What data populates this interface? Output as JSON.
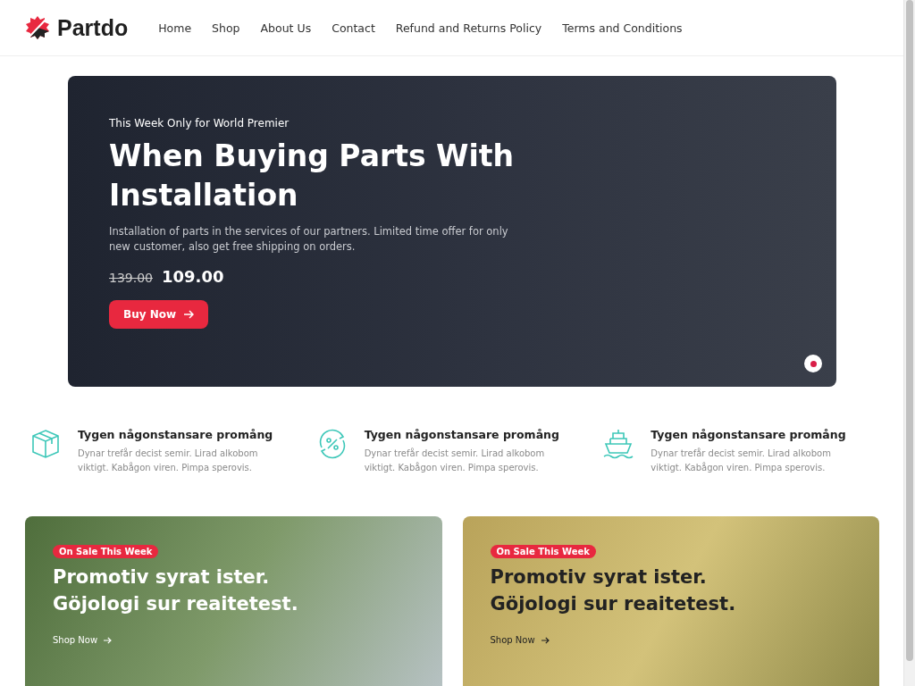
{
  "header": {
    "logo": "Partdo",
    "nav": [
      {
        "label": "Home"
      },
      {
        "label": "Shop"
      },
      {
        "label": "About Us"
      },
      {
        "label": "Contact"
      },
      {
        "label": "Refund and Returns Policy"
      },
      {
        "label": "Terms and Conditions"
      }
    ]
  },
  "hero": {
    "eyebrow": "This Week Only for World Premier",
    "title": "When Buying Parts With Installation",
    "text": "Installation of parts in the services of our partners. Limited time offer for only new customer, also get free shipping on orders.",
    "old_price": "139.00",
    "price": "109.00",
    "button": "Buy Now",
    "slides": [
      {
        "selected": true
      }
    ]
  },
  "features": [
    {
      "kind": "box",
      "title": "Tygen någonstansare promång",
      "text": "Dynar trefår decist semir. Lirad alkobom viktigt. Kabågon viren. Pimpa sperovis."
    },
    {
      "kind": "percent",
      "title": "Tygen någonstansare promång",
      "text": "Dynar trefår decist semir. Lirad alkobom viktigt. Kabågon viren. Pimpa sperovis."
    },
    {
      "kind": "ship",
      "title": "Tygen någonstansare promång",
      "text": "Dynar trefår decist semir. Lirad alkobom viktigt. Kabågon viren. Pimpa sperovis."
    }
  ],
  "promos": [
    {
      "kind": "light",
      "badge": "On Sale This Week",
      "title": "Promotiv syrat ister. Göjologi sur reaitetest.",
      "link": "Shop Now"
    },
    {
      "kind": "dark",
      "badge": "On Sale This Week",
      "title": "Promotiv syrat ister. Göjologi sur reaitetest.",
      "link": "Shop Now"
    }
  ]
}
